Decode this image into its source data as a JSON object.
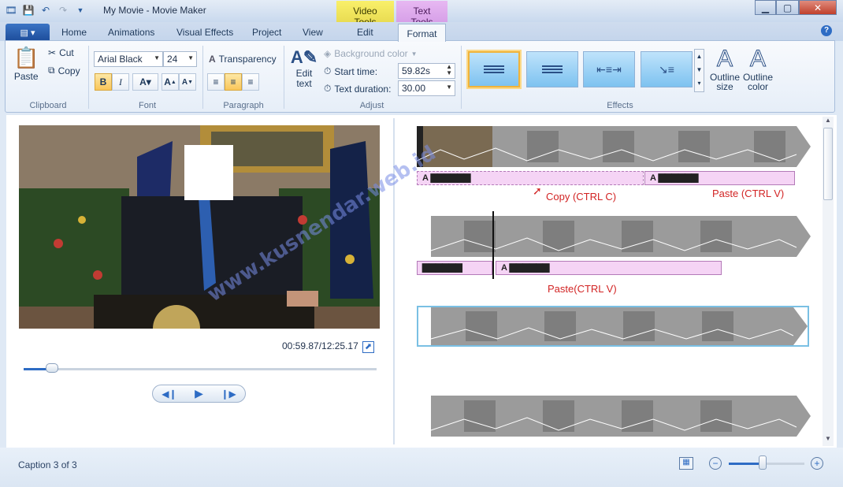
{
  "window": {
    "title": "My Movie - Movie Maker"
  },
  "context_tabs": {
    "video_tools": "Video Tools",
    "text_tools": "Text Tools"
  },
  "tabs": [
    {
      "label": "Home"
    },
    {
      "label": "Animations"
    },
    {
      "label": "Visual Effects"
    },
    {
      "label": "Project"
    },
    {
      "label": "View"
    },
    {
      "label": "Edit"
    },
    {
      "label": "Format"
    }
  ],
  "ribbon": {
    "clipboard": {
      "label": "Clipboard",
      "paste": "Paste",
      "cut": "Cut",
      "copy": "Copy"
    },
    "font": {
      "label": "Font",
      "family": "Arial Black",
      "size": "24",
      "transparency": "Transparency"
    },
    "paragraph": {
      "label": "Paragraph"
    },
    "adjust": {
      "label": "Adjust",
      "edit_text": "Edit text",
      "background_color": "Background color",
      "start_time_label": "Start time:",
      "start_time_value": "59.82s",
      "text_duration_label": "Text duration:",
      "text_duration_value": "30.00"
    },
    "effects": {
      "label": "Effects",
      "outline_size": "Outline size",
      "outline_color": "Outline color"
    }
  },
  "preview": {
    "time": "00:59.87/12:25.17",
    "progress": 0.08
  },
  "timeline": {
    "annotations": {
      "copy": "Copy (CTRL C)",
      "paste1": "Paste (CTRL V)",
      "paste2": "Paste(CTRL V)"
    }
  },
  "watermark": "www.kusnendar.web.id",
  "status": {
    "caption": "Caption 3 of 3",
    "zoom": 0.45
  },
  "colors": {
    "accent": "#2e6cc4",
    "caption_fill": "#f5d4f5",
    "annotation": "#d22424"
  }
}
